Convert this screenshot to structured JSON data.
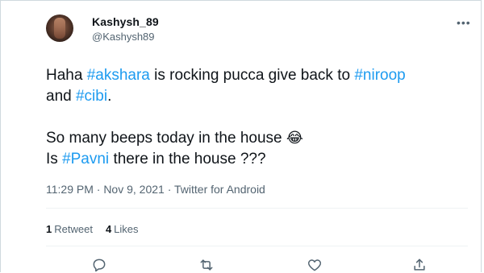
{
  "tweet": {
    "author_name": "Kashysh_89",
    "author_handle": "@Kashysh89",
    "more_icon": "ellipsis-icon",
    "lines": [
      [
        {
          "t": "Haha ",
          "type": "text"
        },
        {
          "t": "#akshara",
          "type": "hashtag"
        },
        {
          "t": " is rocking pucca give back to ",
          "type": "text"
        },
        {
          "t": "#niroop",
          "type": "hashtag"
        }
      ],
      [
        {
          "t": "and ",
          "type": "text"
        },
        {
          "t": "#cibi",
          "type": "hashtag"
        },
        {
          "t": ".",
          "type": "text"
        }
      ],
      [],
      [
        {
          "t": "So many beeps today in the house ",
          "type": "text"
        },
        {
          "t": "😂",
          "type": "emoji"
        }
      ],
      [
        {
          "t": "Is ",
          "type": "text"
        },
        {
          "t": "#Pavni",
          "type": "hashtag"
        },
        {
          "t": " there in the house ???",
          "type": "text"
        }
      ]
    ],
    "meta": "11:29 PM · Nov 9, 2021 · Twitter for Android",
    "stats": {
      "retweets_count": "1",
      "retweets_label": "Retweet",
      "likes_count": "4",
      "likes_label": "Likes"
    },
    "actions": {
      "reply_icon": "reply-icon",
      "retweet_icon": "retweet-icon",
      "like_icon": "like-icon",
      "share_icon": "share-icon"
    },
    "colors": {
      "accent": "#1d9bf0",
      "secondary_text": "#536471",
      "border": "#cfd9de"
    }
  }
}
